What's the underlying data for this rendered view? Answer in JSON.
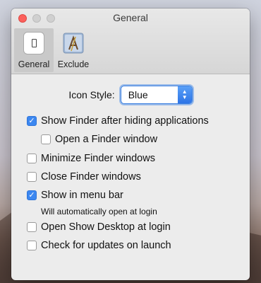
{
  "window": {
    "title": "General"
  },
  "toolbar": {
    "items": [
      {
        "label": "General"
      },
      {
        "label": "Exclude"
      }
    ]
  },
  "icon_style": {
    "label": "Icon Style:",
    "value": "Blue"
  },
  "options": [
    {
      "label": "Show Finder after hiding applications",
      "checked": true
    },
    {
      "label": "Open a Finder window",
      "checked": false
    },
    {
      "label": "Minimize Finder windows",
      "checked": false
    },
    {
      "label": "Close Finder windows",
      "checked": false
    },
    {
      "label": "Show in menu bar",
      "checked": true
    },
    {
      "label": "Open Show Desktop at login",
      "checked": false
    },
    {
      "label": "Check for updates on launch",
      "checked": false
    }
  ],
  "note": "Will automatically open at login",
  "colors": {
    "accent": "#3c87f0",
    "close": "#fc605c"
  }
}
